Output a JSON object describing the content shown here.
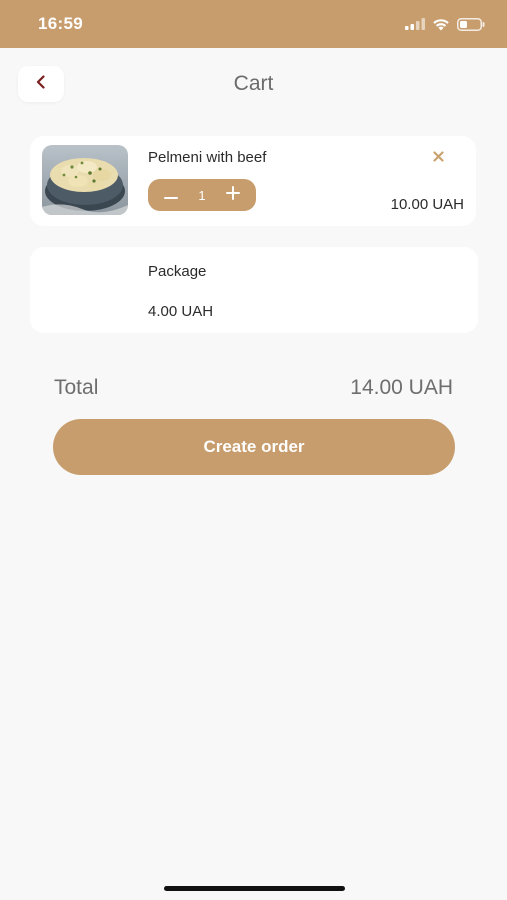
{
  "status_bar": {
    "time": "16:59",
    "signal_icon": "cellular-signal-icon",
    "wifi_icon": "wifi-icon",
    "battery_icon": "battery-icon"
  },
  "header": {
    "back_icon": "chevron-left-icon",
    "title": "Cart"
  },
  "cart_items": [
    {
      "name": "Pelmeni with beef",
      "quantity": "1",
      "price": "10.00 UAH",
      "image": "pelmeni-dish-image",
      "remove_icon": "close-icon",
      "minus_icon": "minus-icon",
      "plus_icon": "plus-icon"
    }
  ],
  "package": {
    "name": "Package",
    "price": "4.00 UAH"
  },
  "total": {
    "label": "Total",
    "value": "14.00 UAH"
  },
  "actions": {
    "create_order_label": "Create order"
  },
  "colors": {
    "accent": "#c79d6d",
    "background": "#f8f8f8",
    "card": "#ffffff",
    "remove_icon": "#c9a36e",
    "back_icon": "#7a1f1f"
  }
}
